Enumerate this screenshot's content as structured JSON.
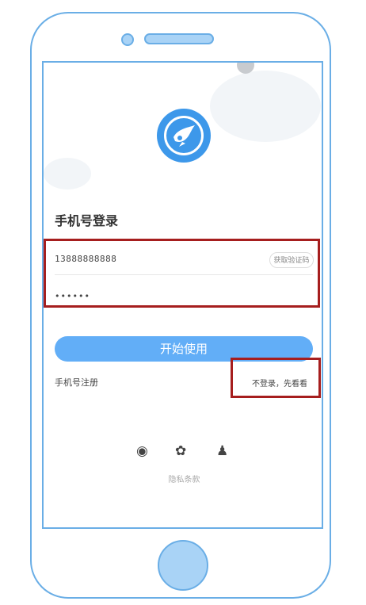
{
  "login": {
    "title": "手机号登录",
    "phone_value": "13888888888",
    "get_code_label": "获取验证码",
    "password_value": "••••••",
    "start_button_label": "开始使用",
    "register_label": "手机号注册",
    "skip_label": "不登录，先看看",
    "privacy_label": "隐私条款"
  },
  "social": {
    "icons": [
      "weibo-icon",
      "wechat-icon",
      "qq-icon"
    ],
    "glyphs": [
      "◉",
      "✿",
      "♟"
    ]
  },
  "colors": {
    "accent": "#3d98ea",
    "button": "#62aef7",
    "highlight": "#a61e1e",
    "device_outline": "#6aaee6"
  }
}
